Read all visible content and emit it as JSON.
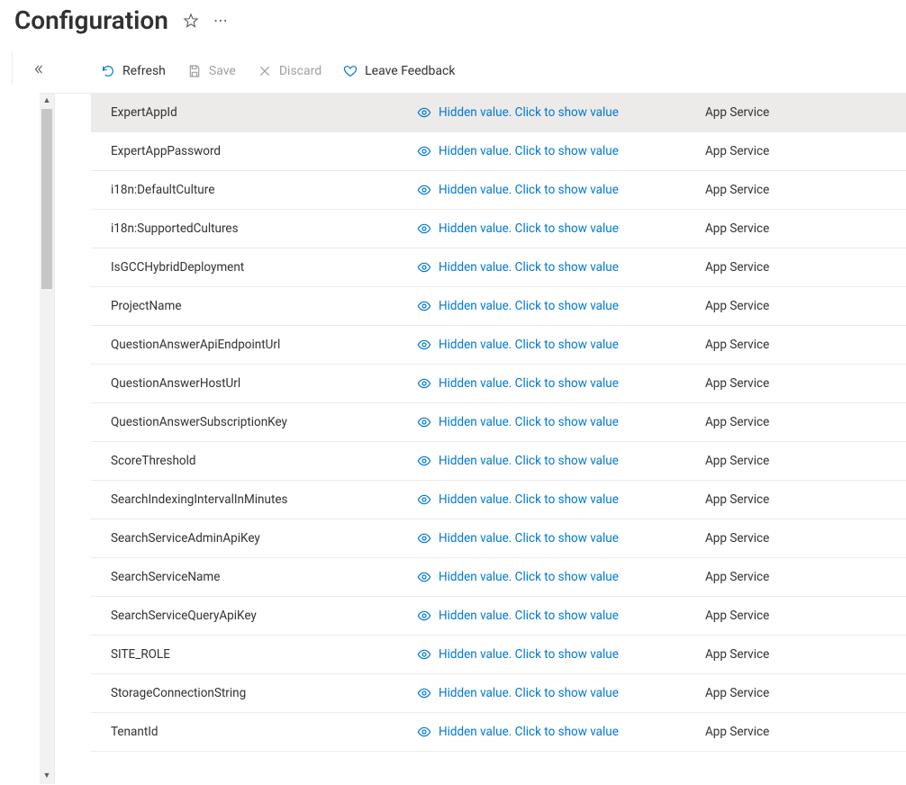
{
  "header": {
    "title": "Configuration"
  },
  "toolbar": {
    "refresh": "Refresh",
    "save": "Save",
    "discard": "Discard",
    "feedback": "Leave Feedback"
  },
  "table": {
    "hidden_value_label": "Hidden value. Click to show value",
    "source_label": "App Service",
    "rows": [
      {
        "name": "ExpertAppId",
        "selected": true
      },
      {
        "name": "ExpertAppPassword"
      },
      {
        "name": "i18n:DefaultCulture"
      },
      {
        "name": "i18n:SupportedCultures"
      },
      {
        "name": "IsGCCHybridDeployment"
      },
      {
        "name": "ProjectName"
      },
      {
        "name": "QuestionAnswerApiEndpointUrl"
      },
      {
        "name": "QuestionAnswerHostUrl"
      },
      {
        "name": "QuestionAnswerSubscriptionKey"
      },
      {
        "name": "ScoreThreshold"
      },
      {
        "name": "SearchIndexingIntervalInMinutes"
      },
      {
        "name": "SearchServiceAdminApiKey"
      },
      {
        "name": "SearchServiceName"
      },
      {
        "name": "SearchServiceQueryApiKey"
      },
      {
        "name": "SITE_ROLE"
      },
      {
        "name": "StorageConnectionString"
      },
      {
        "name": "TenantId"
      }
    ]
  }
}
